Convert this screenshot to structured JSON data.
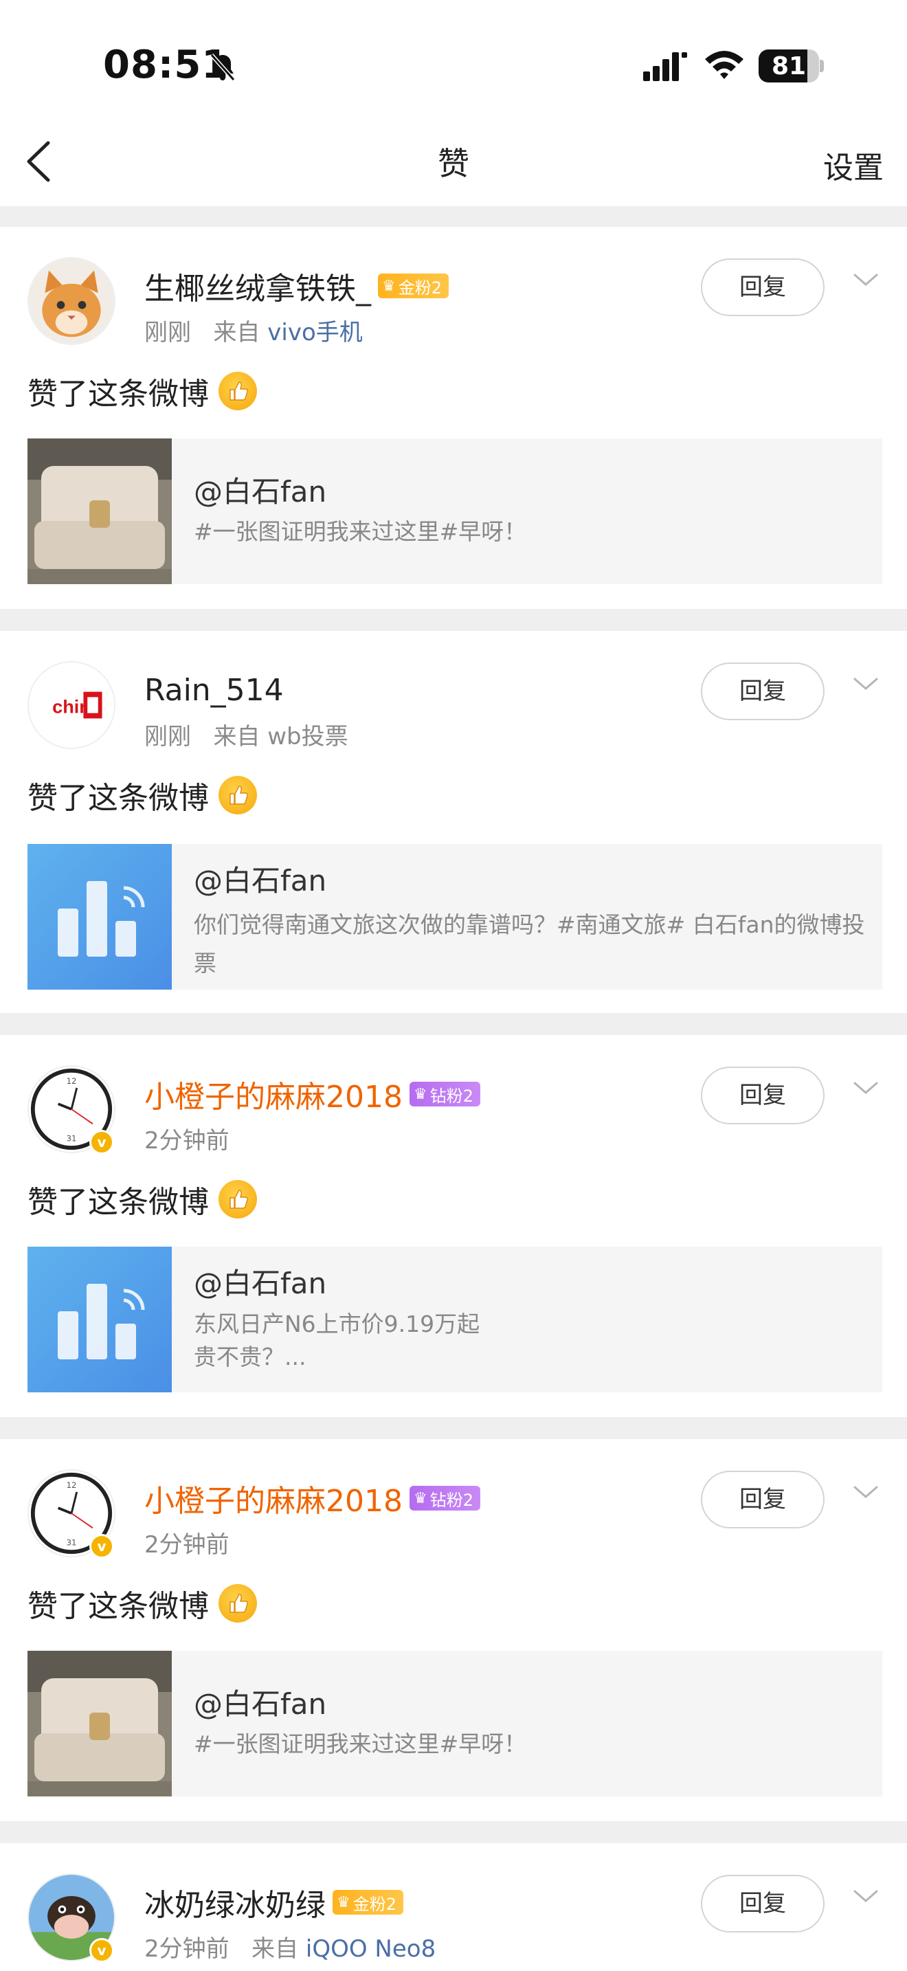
{
  "status_bar": {
    "time": "08:51",
    "battery": "81",
    "battery_fill": 0.81
  },
  "nav": {
    "title": "赞",
    "settings": "设置"
  },
  "colors": {
    "link": "#4a6fa5",
    "vip_name": "#f06400",
    "gold_badge": "#ffb21e",
    "diamond_badge": "#b56cf0"
  },
  "likes": [
    {
      "username": "生椰丝绒拿铁铁_",
      "badge": "金粉2",
      "badge_type": "gold",
      "time": "刚刚",
      "source_prefix": "来自",
      "source": "vivo手机",
      "liked_text": "赞了这条微博",
      "reply_label": "回复",
      "quote_author": "@白石fan",
      "quote_text": "#一张图证明我来过这里#早呀！",
      "thumb": "car-seat-photo"
    },
    {
      "username": "Rain_514",
      "time": "刚刚",
      "source_prefix": "来自",
      "source": "wb投票",
      "liked_text": "赞了这条微博",
      "reply_label": "回复",
      "quote_author": "@白石fan",
      "quote_text": "你们觉得南通文旅这次做的靠谱吗？#南通文旅# 白石fan的微博投票",
      "thumb": "poll-icon"
    },
    {
      "username": "小橙子的麻麻2018",
      "badge": "钻粉2",
      "badge_type": "diamond",
      "time": "2分钟前",
      "liked_text": "赞了这条微博",
      "reply_label": "回复",
      "quote_author": "@白石fan",
      "quote_text_line1": "东风日产N6上市价9.19万起",
      "quote_text_line2": "贵不贵？...",
      "thumb": "poll-icon"
    },
    {
      "username": "小橙子的麻麻2018",
      "badge": "钻粉2",
      "badge_type": "diamond",
      "time": "2分钟前",
      "liked_text": "赞了这条微博",
      "reply_label": "回复",
      "quote_author": "@白石fan",
      "quote_text": "#一张图证明我来过这里#早呀！",
      "thumb": "car-seat-photo"
    },
    {
      "username": "冰奶绿冰奶绿",
      "badge": "金粉2",
      "badge_type": "gold",
      "time": "2分钟前",
      "source_prefix": "来自",
      "source": "iQOO Neo8",
      "reply_label": "回复"
    }
  ]
}
